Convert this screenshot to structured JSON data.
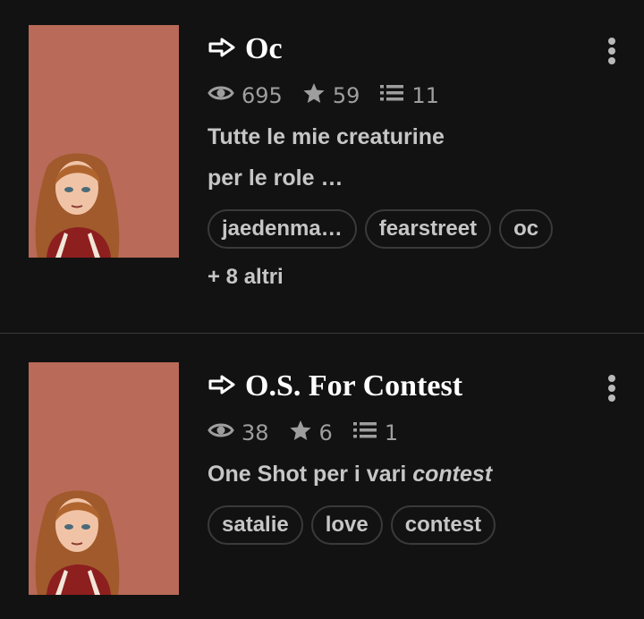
{
  "colors": {
    "background": "#121212",
    "cover": "#b96a58",
    "title": "#ffffff",
    "meta": "#9e9e9e",
    "text": "#c6c6c6"
  },
  "stories": [
    {
      "title": "Oc",
      "icons": [
        "arrow-right-outline-icon",
        "eye-icon",
        "star-icon",
        "list-icon",
        "kebab-menu-icon"
      ],
      "views": "695",
      "stars": "59",
      "parts": "11",
      "description_line1": "Tutte le mie creaturine",
      "description_line2": "per le role …",
      "tags": [
        "jaedenma…",
        "fearstreet",
        "oc"
      ],
      "more_tags": "+ 8 altri"
    },
    {
      "title": "O.S. For Contest",
      "icons": [
        "arrow-right-outline-icon",
        "eye-icon",
        "star-icon",
        "list-icon",
        "kebab-menu-icon"
      ],
      "views": "38",
      "stars": "6",
      "parts": "1",
      "description_prefix": "One Shot per i vari ",
      "description_italic": "contest",
      "tags": [
        "satalie",
        "love",
        "contest"
      ]
    }
  ]
}
